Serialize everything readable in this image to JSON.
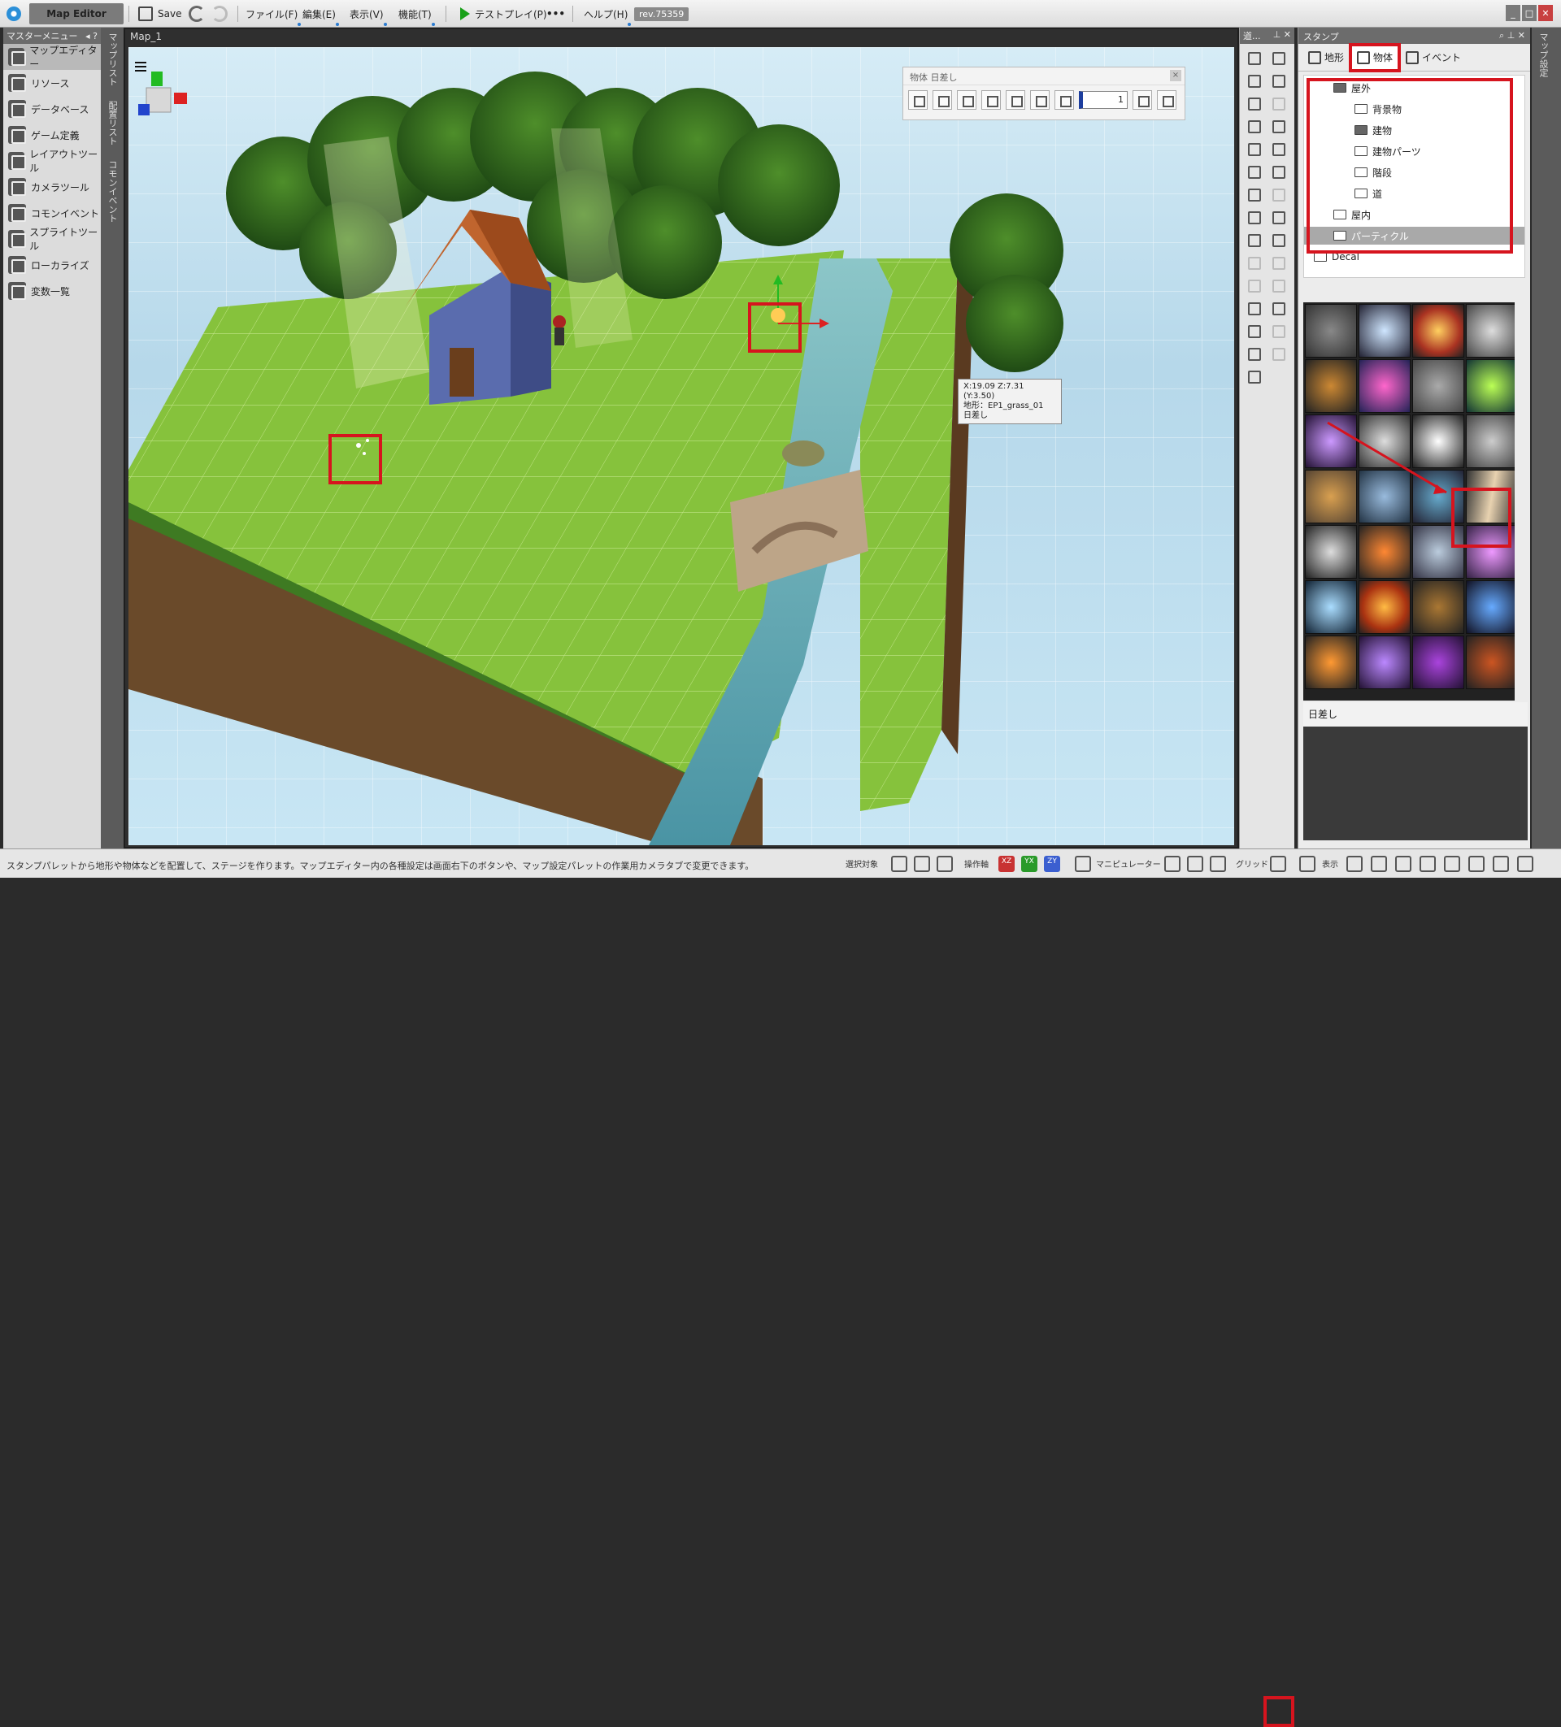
{
  "app": {
    "title": "Map Editor",
    "save_label": "Save",
    "menus": [
      "ファイル(F)",
      "編集(E)",
      "表示(V)",
      "機能(T)"
    ],
    "testplay_label": "テストプレイ(P)",
    "more_label": "•••",
    "help_label": "ヘルプ(H)",
    "revision": "rev.75359"
  },
  "master_menu": {
    "title": "マスターメニュー",
    "items": [
      {
        "label": "マップエディター",
        "active": true
      },
      {
        "label": "リソース"
      },
      {
        "label": "データベース"
      },
      {
        "label": "ゲーム定義"
      },
      {
        "label": "レイアウトツール"
      },
      {
        "label": "カメラツール"
      },
      {
        "label": "コモンイベント"
      },
      {
        "label": "スプライトツール"
      },
      {
        "label": "ローカライズ"
      },
      {
        "label": "変数一覧"
      }
    ]
  },
  "vertical_tabs": [
    "マップリスト",
    "配置リスト",
    "コモンイベント"
  ],
  "viewport": {
    "map_tab": "Map_1",
    "float_toolbar_title": "物体 日差し",
    "float_toolbar_value": "1",
    "tooltip_lines": [
      "X:19.09 Z:7.31 (Y:3.50)",
      "地形：EP1_grass_01",
      "日差し"
    ]
  },
  "tool_palette": {
    "title": "道..."
  },
  "stamp_panel": {
    "title": "スタンプ",
    "tabs": [
      {
        "label": "地形"
      },
      {
        "label": "物体",
        "active": true
      },
      {
        "label": "イベント"
      }
    ],
    "tree": [
      {
        "label": "屋外",
        "level": 1,
        "open": true
      },
      {
        "label": "背景物",
        "level": 2
      },
      {
        "label": "建物",
        "level": 2,
        "open": true
      },
      {
        "label": "建物パーツ",
        "level": 2
      },
      {
        "label": "階段",
        "level": 2
      },
      {
        "label": "道",
        "level": 2
      },
      {
        "label": "屋内",
        "level": 1
      },
      {
        "label": "パーティクル",
        "level": 1,
        "selected": true
      },
      {
        "label": "Decal",
        "level": 0
      }
    ],
    "selected_name": "日差し"
  },
  "right_edge_tab": "マップ設定",
  "status": {
    "message": "スタンプパレットから地形や物体などを配置して、ステージを作ります。マップエディター内の各種設定は画面右下のボタンや、マップ設定パレットの作業用カメラタブで変更できます。",
    "select_target": "選択対象",
    "operation_axis": "操作軸",
    "axis_xz": "XZ",
    "axis_yx": "YX",
    "axis_zy": "ZY",
    "manipulator": "マニピュレーター",
    "grid": "グリッド",
    "display": "表示"
  },
  "colors": {
    "accent_red": "#d6141e",
    "grass": "#8cc63f",
    "water": "#5aa6b0"
  }
}
